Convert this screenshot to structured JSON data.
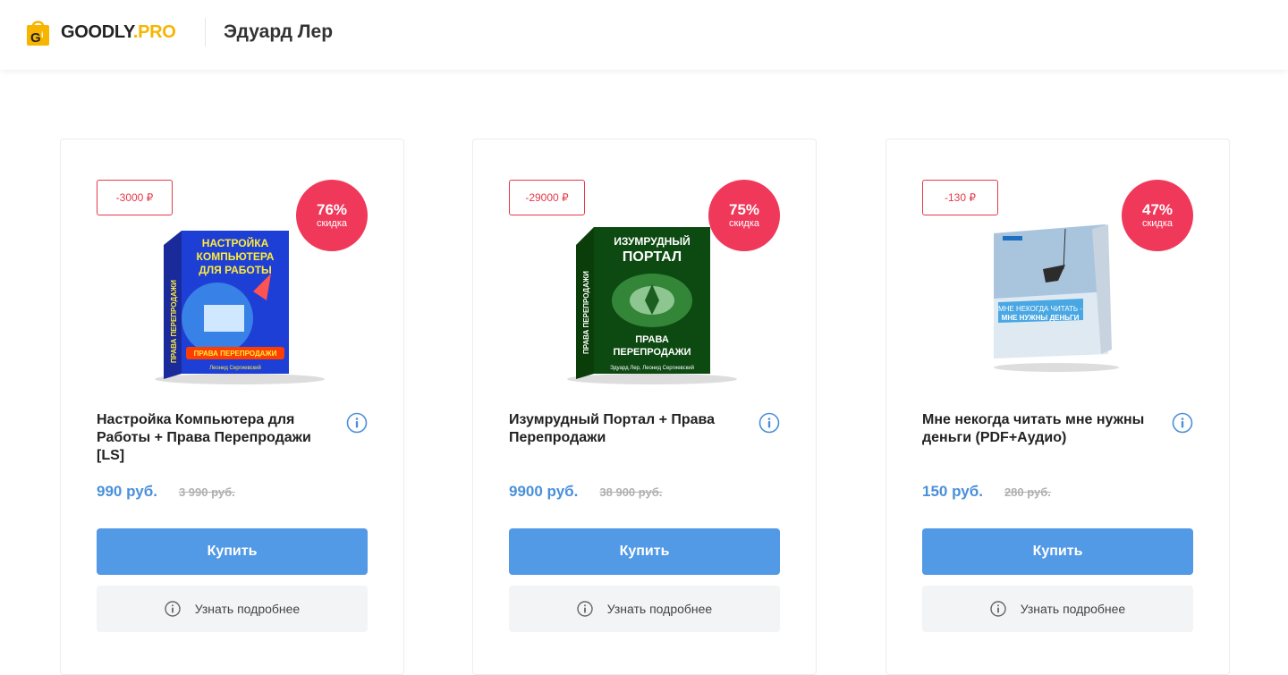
{
  "header": {
    "logo_main": "GOODLY",
    "logo_accent": ".PRO",
    "author": "Эдуард Лер"
  },
  "products": [
    {
      "discount_amount": "-3000 ₽",
      "discount_percent": "76%",
      "discount_label": "скидка",
      "box_title": "НАСТРОЙКА КОМПЬЮТЕРА ДЛЯ РАБОТЫ",
      "box_side": "ПРАВА ПЕРЕПРОДАЖИ",
      "box_ribbon": "ПРАВА ПЕРЕПРОДАЖИ",
      "box_author": "Леонид Сергиевский",
      "title": "Настройка Компьютера для Работы + Права Перепродажи [LS]",
      "price": "990 руб.",
      "old_price": "3 990 руб.",
      "buy_label": "Купить",
      "more_label": "Узнать подробнее"
    },
    {
      "discount_amount": "-29000 ₽",
      "discount_percent": "75%",
      "discount_label": "скидка",
      "box_title": "ИЗУМРУДНЫЙ ПОРТАЛ",
      "box_side": "ПРАВА ПЕРЕПРОДАЖИ",
      "box_ribbon": "ПРАВА ПЕРЕПРОДАЖИ",
      "box_author": "Эдуард Лер, Леонид Сергиевский",
      "title": "Изумрудный Портал + Права Перепродажи",
      "price": "9900 руб.",
      "old_price": "38 900 руб.",
      "buy_label": "Купить",
      "more_label": "Узнать подробнее"
    },
    {
      "discount_amount": "-130 ₽",
      "discount_percent": "47%",
      "discount_label": "скидка",
      "box_title": "МНЕ НЕКОГДА ЧИТАТЬ -",
      "box_side": "МНЕ НУЖНЫ ДЕНЬГИ",
      "box_ribbon": "",
      "box_author": "",
      "title": "Мне некогда читать мне нужны деньги (PDF+Аудио)",
      "price": "150 руб.",
      "old_price": "280 руб.",
      "buy_label": "Купить",
      "more_label": "Узнать подробнее"
    }
  ]
}
